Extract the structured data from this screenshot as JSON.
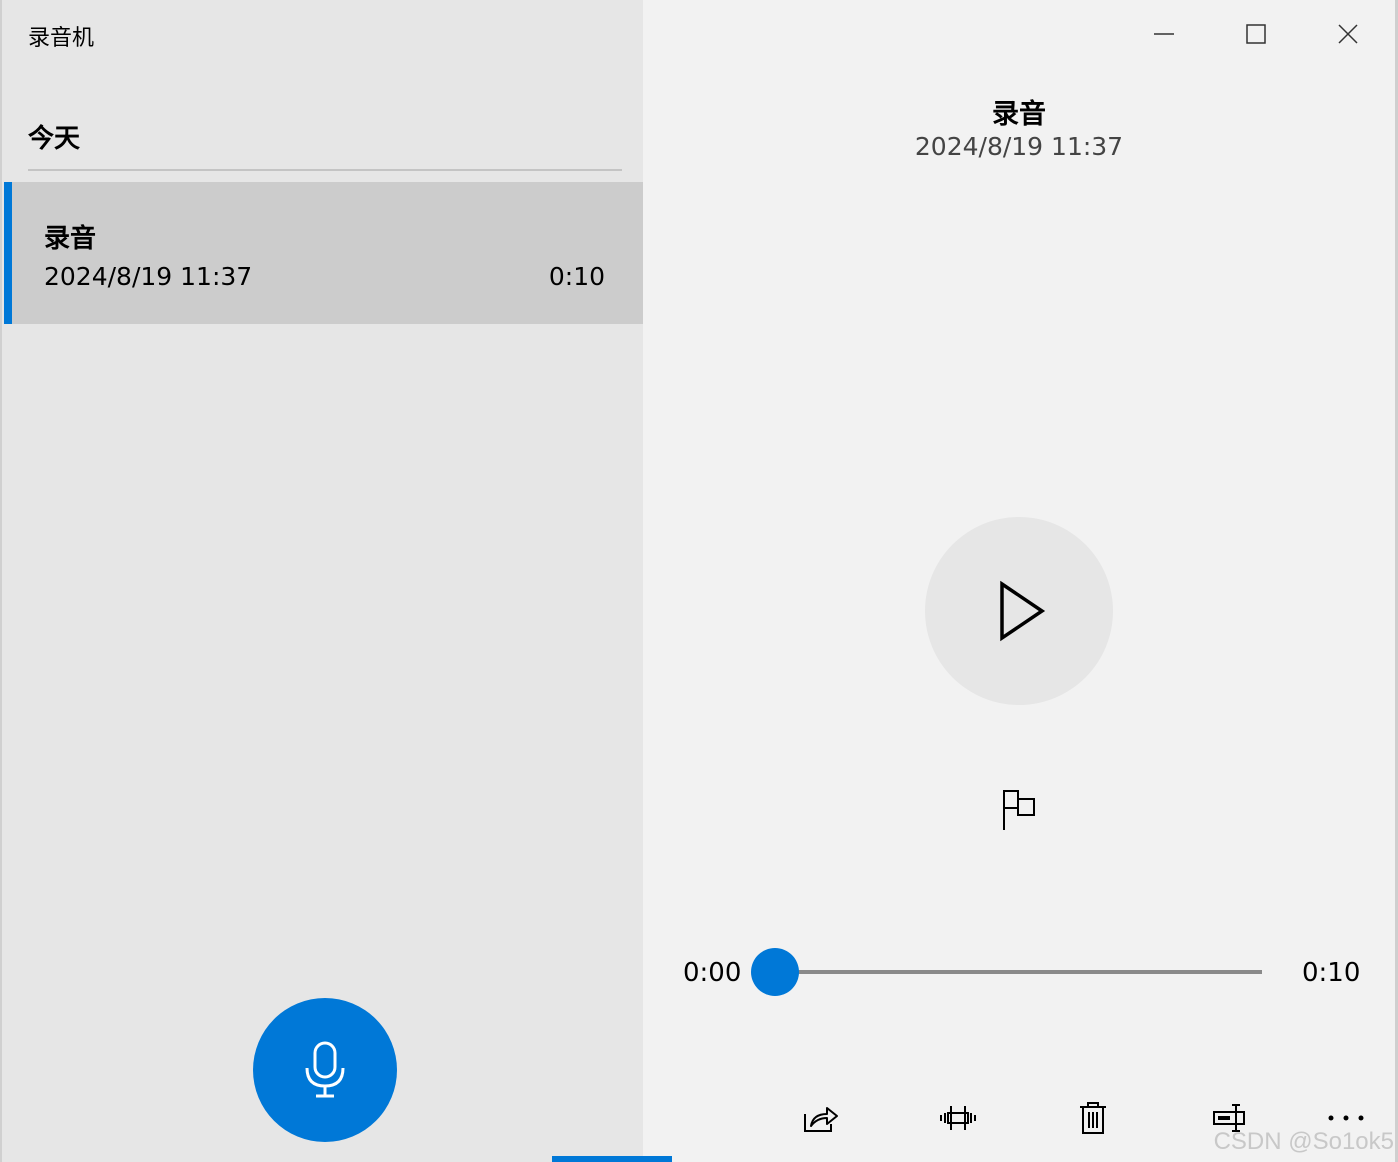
{
  "app": {
    "title": "录音机"
  },
  "list": {
    "group_header": "今天",
    "items": [
      {
        "title": "录音",
        "date": "2024/8/19 11:37",
        "duration": "0:10"
      }
    ]
  },
  "detail": {
    "title": "录音",
    "date": "2024/8/19 11:37",
    "current_time": "0:00",
    "total_time": "0:10",
    "progress_fraction": 0.0
  },
  "icons": {
    "microphone": "microphone-icon",
    "play": "play-icon",
    "flag": "flag-icon",
    "share": "share-icon",
    "trim": "trim-icon",
    "delete": "delete-icon",
    "rename": "rename-icon",
    "more": "more-icon",
    "minimize": "minimize-icon",
    "maximize": "maximize-icon",
    "close": "close-icon"
  },
  "colors": {
    "accent": "#0078d7",
    "pane_left": "#e6e6e6",
    "pane_right": "#f2f2f2",
    "selected": "#cccccc"
  },
  "watermark": "CSDN @So1ok5"
}
